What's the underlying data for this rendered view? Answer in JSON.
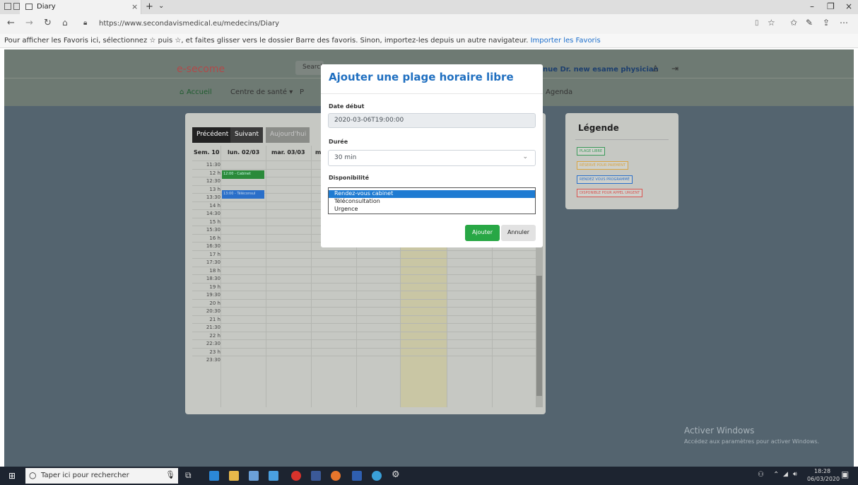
{
  "browser": {
    "tab_title": "Diary",
    "url": "https://www.secondavismedical.eu/medecins/Diary",
    "favorites_bar_text": "Pour afficher les Favoris ici, sélectionnez ☆ puis ☆, et faites glisser vers le dossier Barre des favoris. Sinon, importez-les depuis un autre navigateur.",
    "favorites_import_link": "Importer les Favoris"
  },
  "site": {
    "logo": "e-secome",
    "search_placeholder": "Search",
    "welcome": "nue Dr. new esame physician",
    "nav": {
      "accueil": "Accueil",
      "centre": "Centre de santé ▾",
      "partial": "P",
      "agenda": "Agenda"
    }
  },
  "calendar": {
    "prev": "Précédent",
    "next": "Suivant",
    "today": "Aujourd'hui",
    "week": "Sem. 10",
    "days": [
      "lun. 02/03",
      "mar. 03/03",
      "m"
    ],
    "times": [
      "11:30",
      "12 h",
      "12:30",
      "13 h",
      "13:30",
      "14 h",
      "14:30",
      "15 h",
      "15:30",
      "16 h",
      "16:30",
      "17 h",
      "17:30",
      "18 h",
      "18:30",
      "19 h",
      "19:30",
      "20 h",
      "20:30",
      "21 h",
      "21:30",
      "22 h",
      "22:30",
      "23 h",
      "23:30"
    ],
    "events": [
      {
        "label": "12:00 - Cabinet",
        "color": "#2a8a3a"
      },
      {
        "label": "13:00 - Téléconsul",
        "color": "#2a6fc9"
      }
    ]
  },
  "legend": {
    "title": "Légende",
    "items": [
      {
        "label": "PLAGE LIBRE",
        "color": "#3a9a5a"
      },
      {
        "label": "RÉSERVÉ POUR PAIEMENT",
        "color": "#d9a441"
      },
      {
        "label": "RENDEZ VOUS PROGRAMMÉ",
        "color": "#2a6fc9"
      },
      {
        "label": "DISPONIBLE POUR APPEL URGENT",
        "color": "#d9534f"
      }
    ]
  },
  "modal": {
    "title": "Ajouter une plage horaire libre",
    "date_label": "Date début",
    "date_value": "2020-03-06T19:00:00",
    "duree_label": "Durée",
    "duree_value": "30 min",
    "dispo_label": "Disponibilité",
    "options": [
      "Rendez-vous cabinet",
      "Téléconsultation",
      "Urgence"
    ],
    "selected_option": "Rendez-vous cabinet",
    "ajouter": "Ajouter",
    "annuler": "Annuler"
  },
  "watermark": {
    "title": "Activer Windows",
    "subtitle": "Accédez aux paramètres pour activer Windows."
  },
  "taskbar": {
    "search_placeholder": "Taper ici pour rechercher",
    "time": "18:28",
    "date": "06/03/2020"
  }
}
